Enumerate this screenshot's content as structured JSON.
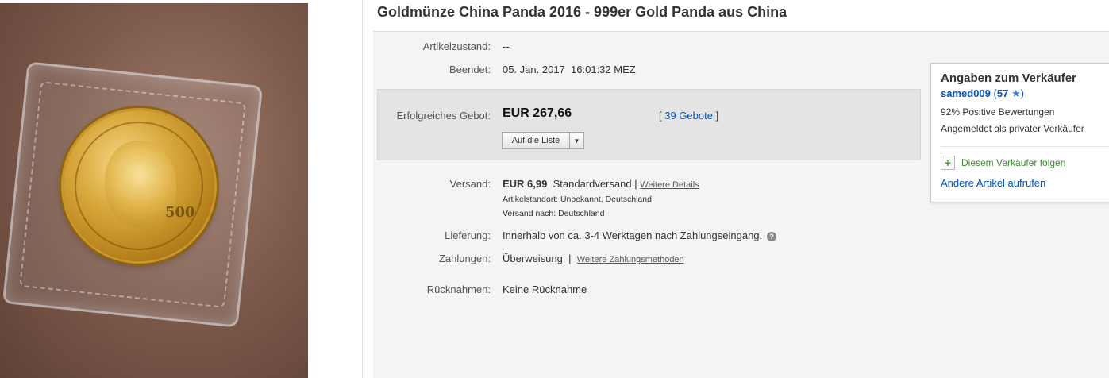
{
  "photo": {
    "coin_text": "500"
  },
  "title": "Goldmünze China Panda 2016 - 999er Gold Panda aus China",
  "condition": {
    "label": "Artikelzustand:",
    "value": "--"
  },
  "ended": {
    "label": "Beendet:",
    "date": "05. Jan. 2017",
    "time": "16:01:32 MEZ"
  },
  "bid": {
    "label": "Erfolgreiches Gebot:",
    "price": "EUR 267,66",
    "bids_open": "[",
    "bids_link": "39 Gebote",
    "bids_close": "]",
    "watch_button": "Auf die Liste"
  },
  "shipping": {
    "label": "Versand:",
    "price": "EUR 6,99",
    "method": "Standardversand",
    "separator": "|",
    "details_link": "Weitere Details",
    "location_label": "Artikelstandort:",
    "location_value": "Unbekannt, Deutschland",
    "ships_to_label": "Versand nach:",
    "ships_to_value": "Deutschland"
  },
  "delivery": {
    "label": "Lieferung:",
    "value": "Innerhalb von ca. 3-4 Werktagen nach Zahlungseingang."
  },
  "payment": {
    "label": "Zahlungen:",
    "value": "Überweisung",
    "separator": "|",
    "more_link": "Weitere Zahlungsmethoden"
  },
  "returns": {
    "label": "Rücknahmen:",
    "value": "Keine Rücknahme"
  },
  "seller": {
    "heading": "Angaben zum Verkäufer",
    "name": "samed009",
    "feedback_open": "(",
    "feedback_count": "57",
    "feedback_close": ")",
    "positive": "92% Positive Bewertungen",
    "type": "Angemeldet als privater Verkäufer",
    "follow": "Diesem Verkäufer folgen",
    "other_items": "Andere Artikel aufrufen"
  },
  "colors": {
    "link": "#0654ba",
    "follow_green": "#3c8e2e",
    "star_blue": "#3a7fd6"
  }
}
